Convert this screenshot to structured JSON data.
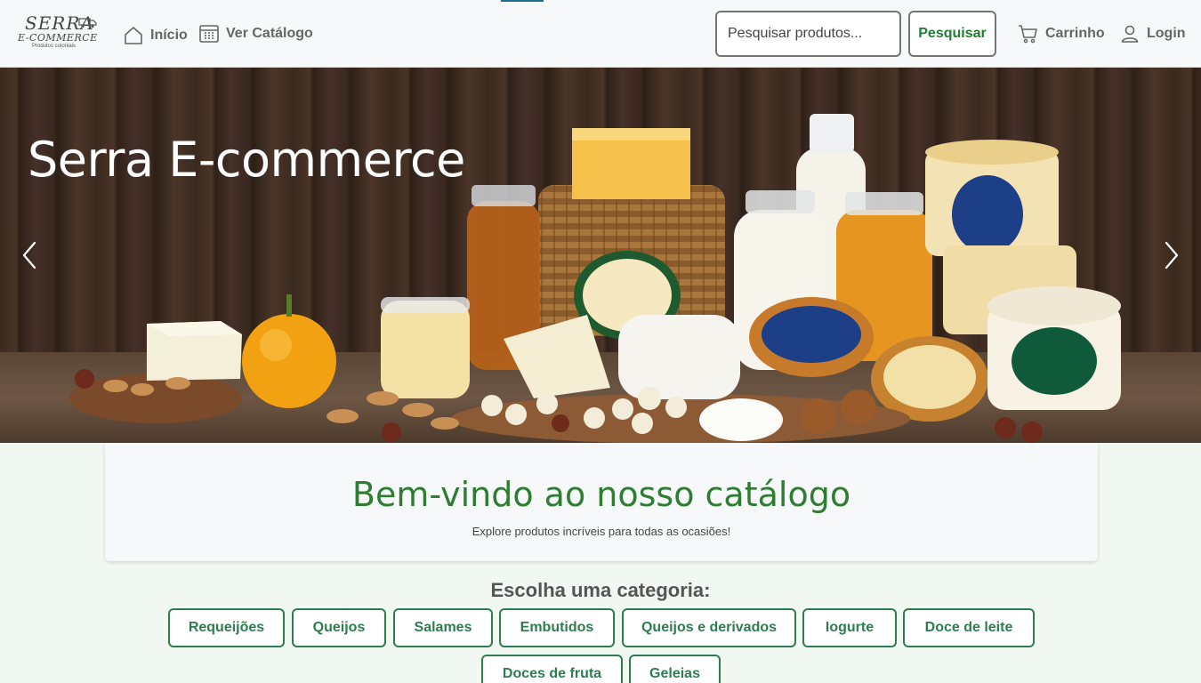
{
  "logo": {
    "line1": "SERRA",
    "line2": "E-COMMERCE",
    "line3": "Produtos coloniais"
  },
  "nav": {
    "home_label": "Início",
    "catalog_label": "Ver Catálogo",
    "cart_label": "Carrinho",
    "login_label": "Login"
  },
  "search": {
    "placeholder": "Pesquisar produtos...",
    "value": "",
    "button_label": "Pesquisar"
  },
  "hero": {
    "title": "Serra E-commerce"
  },
  "welcome": {
    "title": "Bem-vindo ao nosso catálogo",
    "subtitle": "Explore produtos incríveis para todas as ocasiões!"
  },
  "categories": {
    "title": "Escolha uma categoria:",
    "items": [
      "Requeijões",
      "Queijos",
      "Salames",
      "Embutidos",
      "Queijos e derivados",
      "Iogurte",
      "Doce de leite",
      "Doces de fruta",
      "Geleias"
    ]
  },
  "colors": {
    "accent": "#2e7d4f",
    "welcome_title": "#2e7d32",
    "background": "#f1f7f1"
  }
}
